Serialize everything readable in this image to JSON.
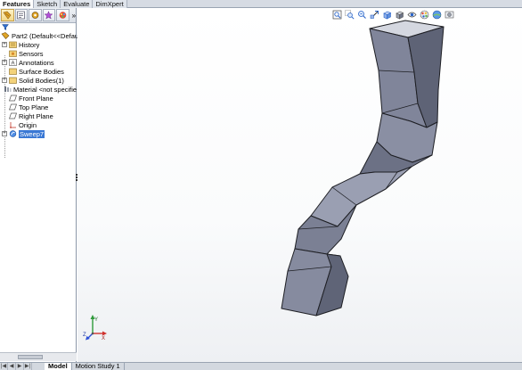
{
  "command_tabs": [
    {
      "label": "Features",
      "active": true
    },
    {
      "label": "Sketch",
      "active": false
    },
    {
      "label": "Evaluate",
      "active": false
    },
    {
      "label": "DimXpert",
      "active": false
    }
  ],
  "feature_manager": {
    "toolbar_more": "»",
    "tree": [
      {
        "label": "Part2  (Default<<Default",
        "icon": "part-icon",
        "expander": "none"
      },
      {
        "label": "History",
        "icon": "history-icon",
        "expander": "+"
      },
      {
        "label": "Sensors",
        "icon": "sensors-icon",
        "expander": "none"
      },
      {
        "label": "Annotations",
        "icon": "annotations-icon",
        "expander": "+"
      },
      {
        "label": "Surface Bodies",
        "icon": "surface-bodies-icon",
        "expander": "none"
      },
      {
        "label": "Solid Bodies(1)",
        "icon": "solid-bodies-icon",
        "expander": "+"
      },
      {
        "label": "Material <not specifie",
        "icon": "material-icon",
        "expander": "none"
      },
      {
        "label": "Front Plane",
        "icon": "plane-icon",
        "expander": "none"
      },
      {
        "label": "Top Plane",
        "icon": "plane-icon",
        "expander": "none"
      },
      {
        "label": "Right Plane",
        "icon": "plane-icon",
        "expander": "none"
      },
      {
        "label": "Origin",
        "icon": "origin-icon",
        "expander": "none"
      },
      {
        "label": "Sweep7",
        "icon": "sweep-icon",
        "expander": "+",
        "selected": true
      }
    ]
  },
  "bottom_tabs": [
    {
      "label": "Model",
      "active": true
    },
    {
      "label": "Motion Study 1",
      "active": false
    }
  ],
  "nav_buttons": [
    "|◀",
    "◀",
    "▶",
    "▶|"
  ],
  "heads_up_toolbar": [
    "zoom-to-fit-icon",
    "zoom-to-area-icon",
    "previous-view-icon",
    "section-view-icon",
    "view-orientation-icon",
    "display-style-icon",
    "hide-show-items-icon",
    "edit-appearance-icon",
    "apply-scene-icon",
    "view-settings-icon"
  ],
  "colors": {
    "accent_selection": "#3a78d4",
    "model_face_light": "#9ea3b4",
    "model_face_mid": "#7f8497",
    "model_face_dark": "#5d6275",
    "triad_x": "#d0312d",
    "triad_y": "#2e9a3a",
    "triad_z": "#2c4fd6"
  },
  "triad_labels": {
    "x": "X",
    "y": "Y",
    "z": "Z"
  }
}
